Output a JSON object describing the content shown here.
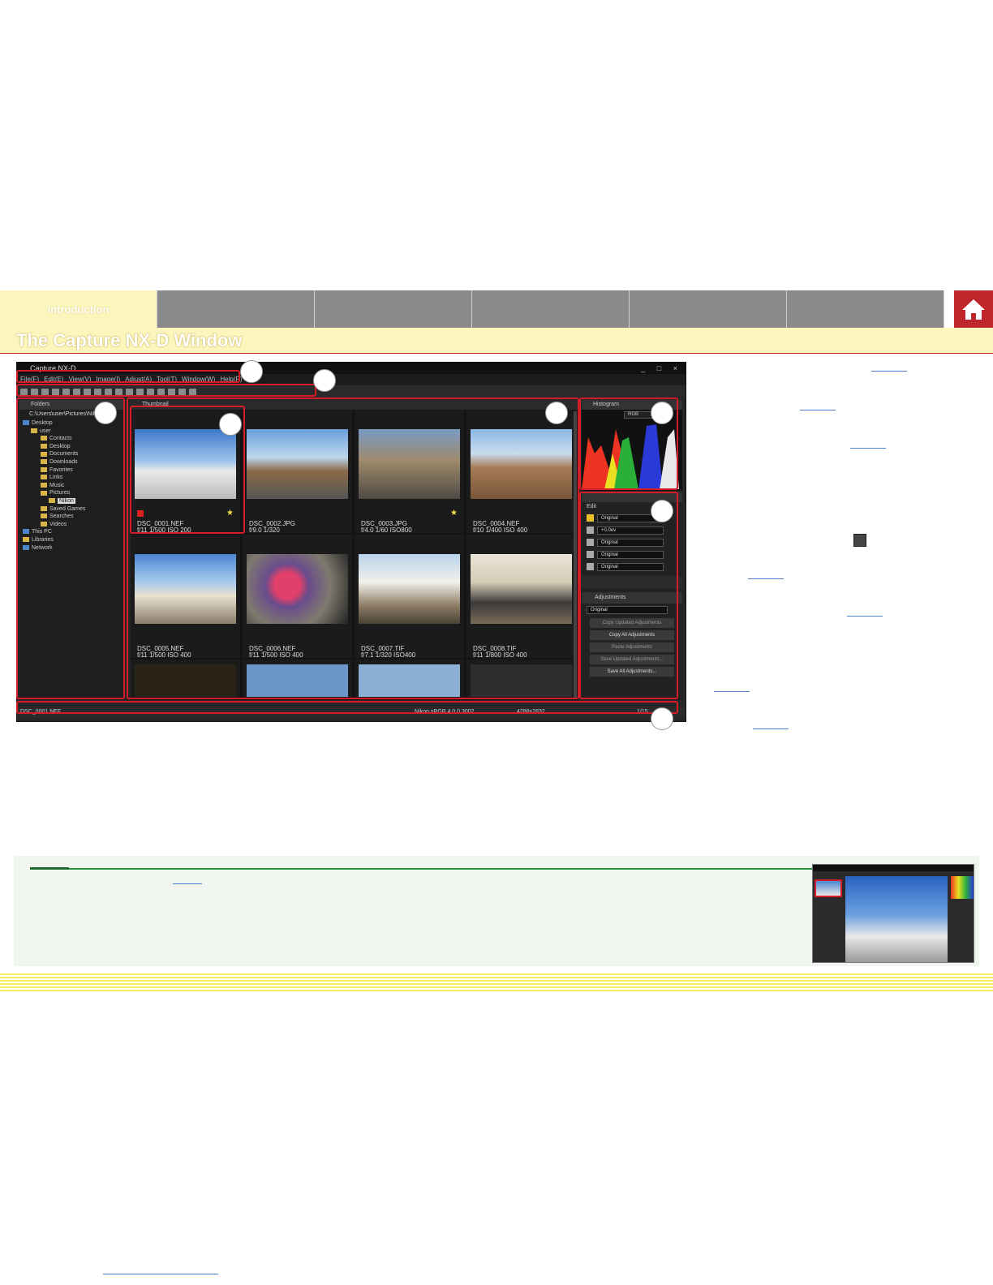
{
  "nav": {
    "tabs": [
      {
        "label": "Introduction",
        "active": true
      },
      {
        "label": "",
        "active": false
      },
      {
        "label": "",
        "active": false
      },
      {
        "label": "",
        "active": false
      },
      {
        "label": "",
        "active": false
      },
      {
        "label": "",
        "active": false
      }
    ],
    "home_icon": "home-icon",
    "accent": "#c0272d",
    "band": "#fcf6bd"
  },
  "page_title": "The Capture NX-D Window",
  "app": {
    "window_title": "Capture NX-D",
    "window_controls": "_ □ ×",
    "menus": [
      "File(F)",
      "Edit(E)",
      "View(V)",
      "Image(I)",
      "Adjust(A)",
      "Tool(T)",
      "Window(W)",
      "Help(P)"
    ],
    "folders_panel": {
      "title": "Folders",
      "path": "C:\\Users\\user\\Pictures\\Nikon",
      "tree": [
        "Desktop",
        "user",
        "Contacts",
        "Desktop",
        "Documents",
        "Downloads",
        "Favorites",
        "Links",
        "Music",
        "Pictures",
        "Nikon",
        "Saved Games",
        "Searches",
        "Videos",
        "This PC",
        "Libraries",
        "Network"
      ]
    },
    "thumb_tab": "Thumbnail",
    "thumbnails": [
      {
        "name": "DSC_0001.NEF",
        "info": "f/11 1/500 ISO 200"
      },
      {
        "name": "DSC_0002.JPG",
        "info": "f/9.0 1/320"
      },
      {
        "name": "DSC_0003.JPG",
        "info": "f/4.0 1/60  ISO800"
      },
      {
        "name": "DSC_0004.NEF",
        "info": "f/10 1/400 ISO 400"
      },
      {
        "name": "DSC_0005.NEF",
        "info": "f/11 1/500 ISO 400"
      },
      {
        "name": "DSC_0006.NEF",
        "info": "f/11 1/500 ISO 400"
      },
      {
        "name": "DSC_0007.TIF",
        "info": "f/7.1 1/320 ISO400"
      },
      {
        "name": "DSC_0008.TIF",
        "info": "f/11 1/800 ISO 400"
      }
    ],
    "histogram": {
      "title": "Histogram",
      "channel": "RGB"
    },
    "edit": {
      "label": "Edit",
      "rows": [
        "Original",
        "+0.0ev",
        "Original",
        "Original",
        "Original"
      ],
      "adjustments_title": "Adjustments",
      "adjustments_value": "Original",
      "buttons": [
        "Copy Updated Adjustments",
        "Copy All Adjustments",
        "Paste Adjustments",
        "Save Updated Adjustments...",
        "Save All Adjustments..."
      ]
    },
    "status": {
      "file": "DSC_0001.NEF",
      "profile": "Nikon sRGB 4.0.0.3002",
      "size": "4288x2832",
      "counter": "1/15"
    }
  }
}
